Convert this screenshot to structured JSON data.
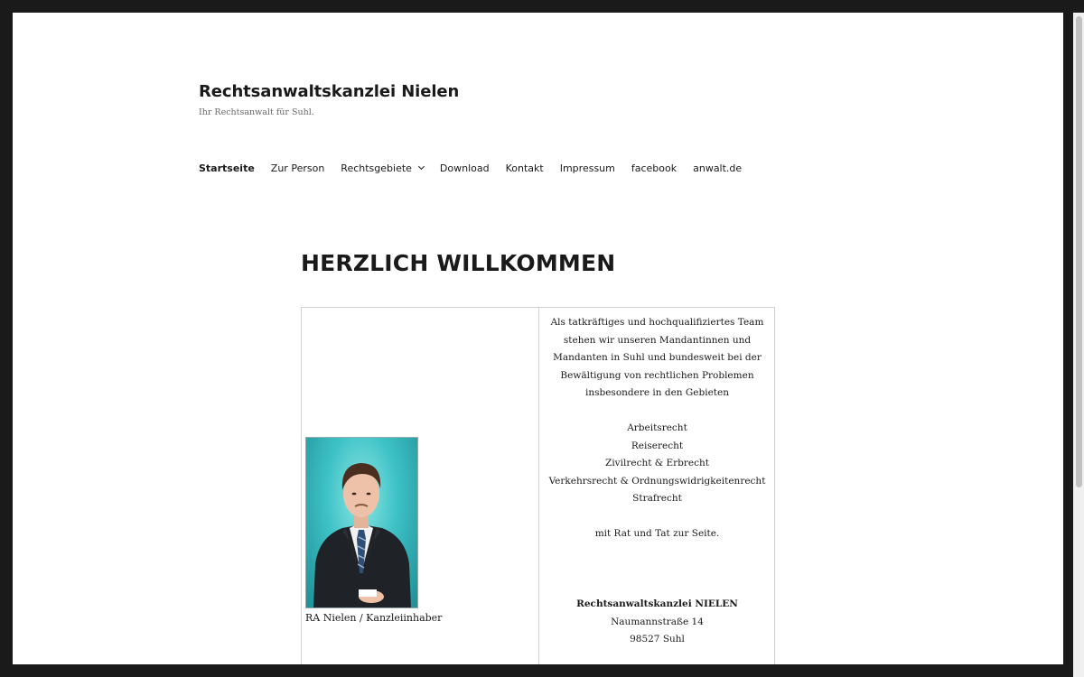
{
  "site": {
    "title": "Rechtsanwaltskanzlei Nielen",
    "description": "Ihr Rechtsanwalt für Suhl."
  },
  "nav": {
    "items": [
      {
        "label": "Startseite",
        "active": true
      },
      {
        "label": "Zur Person"
      },
      {
        "label": "Rechtsgebiete",
        "has_dropdown": true
      },
      {
        "label": "Download"
      },
      {
        "label": "Kontakt"
      },
      {
        "label": "Impressum"
      },
      {
        "label": "facebook"
      },
      {
        "label": "anwalt.de"
      }
    ]
  },
  "page": {
    "title": "HERZLICH WILLKOMMEN"
  },
  "left_cell": {
    "caption": "RA Nielen / Kanzleiinhaber"
  },
  "right_cell": {
    "intro": [
      "Als tatkräftiges und hochqualifiziertes Team",
      "stehen wir unseren Mandantinnen und",
      "Mandanten in Suhl und bundesweit bei der",
      "Bewältigung von rechtlichen Problemen",
      "insbesondere in den Gebieten"
    ],
    "areas": [
      "Arbeitsrecht",
      "Reiserecht",
      "Zivilrecht & Erbrecht",
      "Verkehrsrecht & Ordnungswidrigkeitenrecht",
      "Strafrecht"
    ],
    "closing": "mit Rat und Tat zur Seite.",
    "address": {
      "name": "Rechtsanwaltskanzlei NIELEN",
      "street": "Naumannstraße 14",
      "city": "98527 Suhl"
    }
  },
  "colors": {
    "text": "#1a1a1a",
    "muted": "#686868",
    "border": "#d1d1d1",
    "frame_bg": "#1a1a1a"
  }
}
